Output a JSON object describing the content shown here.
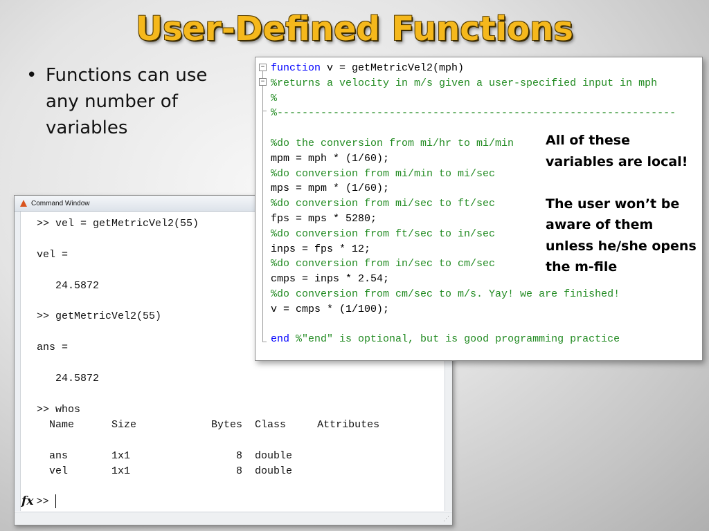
{
  "slide": {
    "title": "User-Defined Functions",
    "bullet": "Functions can use any number of variables"
  },
  "command_window": {
    "title": "Command Window",
    "lines": [
      ">> vel = getMetricVel2(55)",
      "",
      "vel =",
      "",
      "   24.5872",
      "",
      ">> getMetricVel2(55)",
      "",
      "ans =",
      "",
      "   24.5872",
      "",
      ">> whos",
      "  Name      Size            Bytes  Class     Attributes",
      "",
      "  ans       1x1                 8  double",
      "  vel       1x1                 8  double"
    ],
    "prompt": ">>"
  },
  "editor": {
    "lines": [
      {
        "kw": "function",
        "code": " v = getMetricVel2(mph)",
        "comment": ""
      },
      {
        "kw": "",
        "code": "",
        "comment": "%returns a velocity in m/s given a user-specified input in mph"
      },
      {
        "kw": "",
        "code": "",
        "comment": "%"
      },
      {
        "kw": "",
        "code": "",
        "comment": "%----------------------------------------------------------------"
      },
      {
        "kw": "",
        "code": "",
        "comment": ""
      },
      {
        "kw": "",
        "code": "",
        "comment": "%do the conversion from mi/hr to mi/min"
      },
      {
        "kw": "",
        "code": "mpm = mph * (1/60);",
        "comment": ""
      },
      {
        "kw": "",
        "code": "",
        "comment": "%do conversion from mi/min to mi/sec"
      },
      {
        "kw": "",
        "code": "mps = mpm * (1/60);",
        "comment": ""
      },
      {
        "kw": "",
        "code": "",
        "comment": "%do conversion from mi/sec to ft/sec"
      },
      {
        "kw": "",
        "code": "fps = mps * 5280;",
        "comment": ""
      },
      {
        "kw": "",
        "code": "",
        "comment": "%do conversion from ft/sec to in/sec"
      },
      {
        "kw": "",
        "code": "inps = fps * 12;",
        "comment": ""
      },
      {
        "kw": "",
        "code": "",
        "comment": "%do conversion from in/sec to cm/sec"
      },
      {
        "kw": "",
        "code": "cmps = inps * 2.54;",
        "comment": ""
      },
      {
        "kw": "",
        "code": "",
        "comment": "%do conversion from cm/sec to m/s. Yay! we are finished!"
      },
      {
        "kw": "",
        "code": "v = cmps * (1/100);",
        "comment": ""
      },
      {
        "kw": "",
        "code": "",
        "comment": ""
      },
      {
        "kw": "end",
        "code": " ",
        "comment": "%\"end\" is optional, but is good programming practice"
      }
    ]
  },
  "annotation": {
    "lines": [
      "All of these",
      "variables are local!",
      "",
      "The user won’t be",
      "aware of them",
      "unless he/she opens",
      "the m-file"
    ]
  }
}
